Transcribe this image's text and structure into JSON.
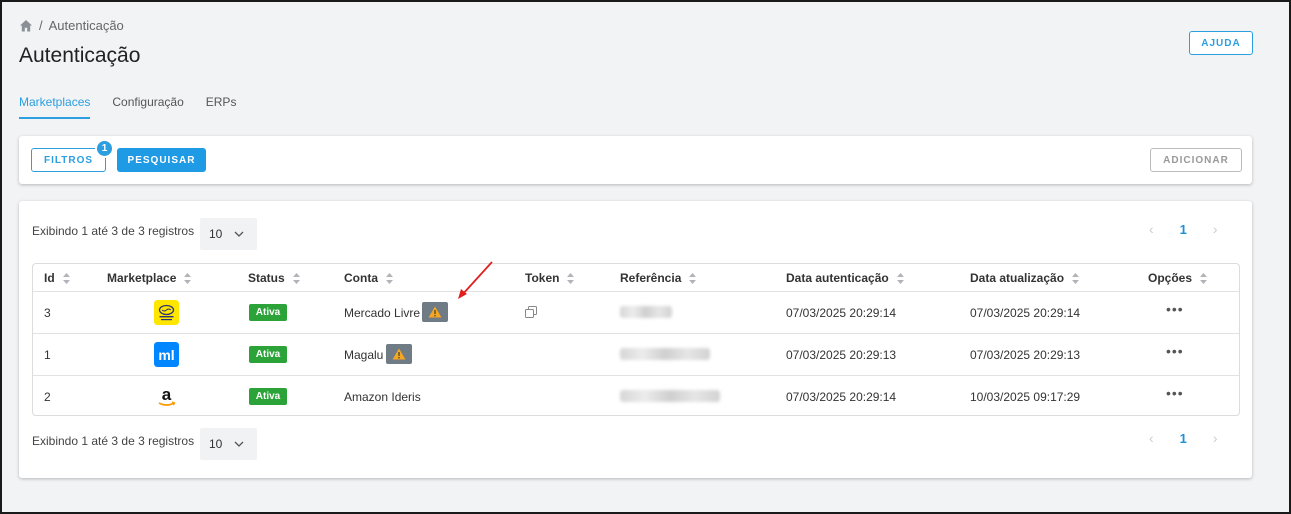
{
  "breadcrumb": {
    "icon": "home-icon",
    "separator": "/",
    "current": "Autenticação"
  },
  "page": {
    "title": "Autenticação",
    "help_label": "AJUDA"
  },
  "tabs": [
    {
      "label": "Marketplaces",
      "active": true
    },
    {
      "label": "Configuração",
      "active": false
    },
    {
      "label": "ERPs",
      "active": false
    }
  ],
  "toolbar": {
    "filters_label": "FILTROS",
    "filters_badge": "1",
    "search_label": "PESQUISAR",
    "add_label": "ADICIONAR"
  },
  "listing": {
    "info_top": "Exibindo 1 até 3 de 3 registros",
    "info_bottom": "Exibindo 1 até 3 de 3 registros",
    "per_page": "10",
    "page": "1",
    "prev_icon": "chevron-left-icon",
    "next_icon": "chevron-right-icon"
  },
  "table": {
    "headers": {
      "id": "Id",
      "marketplace": "Marketplace",
      "status": "Status",
      "conta": "Conta",
      "token": "Token",
      "referencia": "Referência",
      "data_autenticacao": "Data autenticação",
      "data_atualizacao": "Data atualização",
      "opcoes": "Opções"
    },
    "rows": [
      {
        "id": "3",
        "marketplace_icon": "mercado-livre-logo",
        "status": "Ativa",
        "conta": "Mercado Livre",
        "warning": true,
        "token_icon": "copy-icon",
        "data_autenticacao": "07/03/2025 20:29:14",
        "data_atualizacao": "07/03/2025 20:29:14",
        "options": "•••"
      },
      {
        "id": "1",
        "marketplace_icon": "magalu-logo",
        "status": "Ativa",
        "conta": "Magalu",
        "warning": true,
        "token_icon": "",
        "data_autenticacao": "07/03/2025 20:29:13",
        "data_atualizacao": "07/03/2025 20:29:13",
        "options": "•••"
      },
      {
        "id": "2",
        "marketplace_icon": "amazon-logo",
        "status": "Ativa",
        "conta": "Amazon Ideris",
        "warning": false,
        "token_icon": "",
        "data_autenticacao": "07/03/2025 20:29:14",
        "data_atualizacao": "10/03/2025 09:17:29",
        "options": "•••"
      }
    ]
  },
  "colors": {
    "accent": "#2b9fe0",
    "status_active": "#2ca339",
    "warning_bg": "#6f7b85",
    "warning_icon": "#f5a623",
    "annotation_arrow": "#e02020"
  }
}
